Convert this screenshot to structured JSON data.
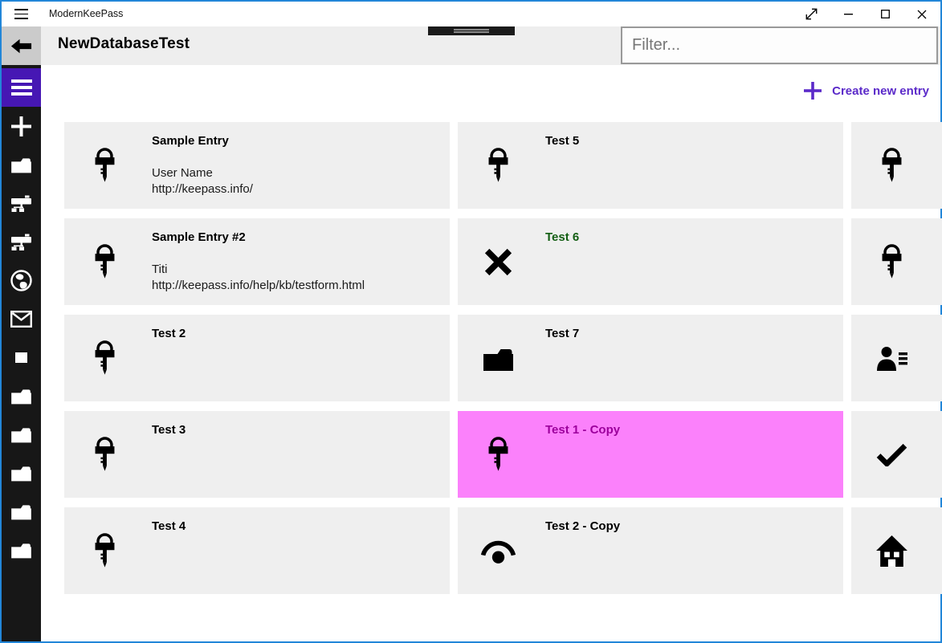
{
  "window": {
    "title": "ModernKeePass",
    "control_icons": [
      "hamburger-menu",
      "fullscreen-diagonal-arrows",
      "minimize",
      "maximize",
      "close"
    ]
  },
  "header": {
    "page_title": "NewDatabaseTest",
    "back_icon": "back-arrow",
    "filter_placeholder": "Filter...",
    "create_button_label": "Create new entry",
    "create_button_icon": "plus"
  },
  "sidebar": {
    "icons": [
      "menu-hamburger",
      "add-plus",
      "folder",
      "network-drive",
      "network-drive",
      "globe",
      "mail-envelope",
      "square",
      "folder",
      "folder",
      "folder",
      "folder",
      "folder"
    ]
  },
  "grid": {
    "cards": [
      {
        "title": "Sample Entry",
        "lines": [
          "User Name",
          "http://keepass.info/"
        ],
        "icon": "key"
      },
      {
        "title": "Test 5",
        "lines": [],
        "icon": "key"
      },
      {
        "title": "",
        "lines": [],
        "icon": "key",
        "clipped": true
      },
      {
        "title": "Sample Entry #2",
        "lines": [
          "Titi",
          "http://keepass.info/help/kb/testform.html"
        ],
        "icon": "key"
      },
      {
        "title": "Test 6",
        "lines": [],
        "icon": "cross",
        "title_color": "#135e13"
      },
      {
        "title": "",
        "lines": [],
        "icon": "key",
        "clipped": true
      },
      {
        "title": "Test 2",
        "lines": [],
        "icon": "key"
      },
      {
        "title": "Test 7",
        "lines": [],
        "icon": "folder"
      },
      {
        "title": "",
        "lines": [],
        "icon": "contact-list",
        "clipped": true
      },
      {
        "title": "Test 3",
        "lines": [],
        "icon": "key"
      },
      {
        "title": "Test 1 - Copy",
        "lines": [],
        "icon": "key",
        "selected": true,
        "title_color": "#9c009c"
      },
      {
        "title": "",
        "lines": [],
        "icon": "check",
        "clipped": true
      },
      {
        "title": "Test 4",
        "lines": [],
        "icon": "key"
      },
      {
        "title": "Test 2 - Copy",
        "lines": [],
        "icon": "eye-arc"
      },
      {
        "title": "",
        "lines": [],
        "icon": "home",
        "clipped": true
      }
    ]
  },
  "colors": {
    "window_border": "#2286d8",
    "sidebar_bg": "#171717",
    "sidebar_accent": "#4617b4",
    "accent_purple": "#5b2ac9",
    "card_bg": "#efefef",
    "selected_card_bg": "#fb81fb",
    "selected_title": "#9c009c",
    "green_title": "#135e13",
    "header_bg": "#eeeeee",
    "back_button_bg": "#cbcbcb"
  }
}
